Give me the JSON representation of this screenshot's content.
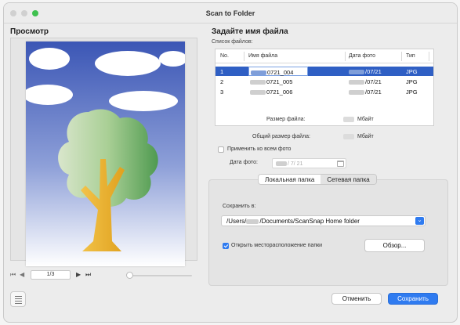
{
  "window": {
    "title": "Scan to Folder"
  },
  "preview": {
    "title": "Просмотр",
    "page_indicator": "1/3"
  },
  "filename": {
    "heading": "Задайте имя файла",
    "list_label": "Список файлов:",
    "columns": [
      "No.",
      "Имя файла",
      "Дата фото",
      "Тип"
    ],
    "rows": [
      {
        "no": "1",
        "name": "0721_004",
        "date": "/07/21",
        "type": "JPG"
      },
      {
        "no": "2",
        "name": "0721_005",
        "date": "/07/21",
        "type": "JPG"
      },
      {
        "no": "3",
        "name": "0721_006",
        "date": "/07/21",
        "type": "JPG"
      }
    ],
    "file_size_label": "Размер файла:",
    "file_size_unit": "Мбайт",
    "total_size_label": "Общий размер файла:",
    "total_size_unit": "Мбайт",
    "apply_all_label": "Применить ко всем фото",
    "photo_date_label": "Дата фото:",
    "photo_date_value": "/   7/ 21"
  },
  "destination": {
    "tab_local": "Локальная папка",
    "tab_network": "Сетевая папка",
    "save_in_label": "Сохранить в:",
    "path_prefix": "/Users/",
    "path_suffix": "/Documents/ScanSnap Home folder",
    "open_location_label": "Открыть месторасположение папки",
    "browse_label": "Обзор..."
  },
  "actions": {
    "cancel": "Отменить",
    "save": "Сохранить"
  },
  "colors": {
    "accent": "#2f7bf0",
    "selection": "#2f5fc4"
  }
}
